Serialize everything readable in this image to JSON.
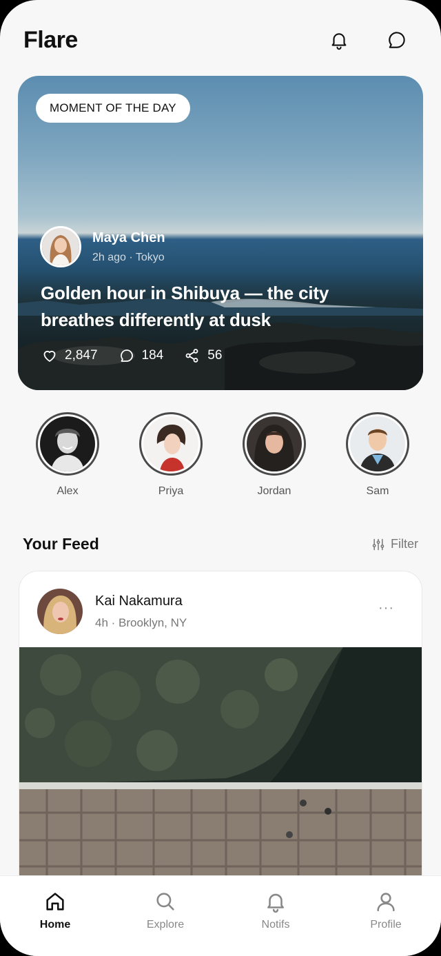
{
  "app": {
    "title": "Flare"
  },
  "header": {
    "icons": [
      "bell-icon",
      "chat-bubble-icon"
    ]
  },
  "hero": {
    "badge": "MOMENT OF THE DAY",
    "author": "Maya Chen",
    "meta": "2h ago · Tokyo",
    "title": "Golden hour in Shibuya — the city breathes differently at dusk",
    "likes": "2,847",
    "comments": "184",
    "shares": "56"
  },
  "stories": [
    {
      "name": "Alex"
    },
    {
      "name": "Priya"
    },
    {
      "name": "Jordan"
    },
    {
      "name": "Sam"
    }
  ],
  "feed": {
    "title": "Your Feed",
    "filter_label": "Filter",
    "post": {
      "author": "Kai Nakamura",
      "meta": "4h · Brooklyn, NY",
      "more": "···"
    }
  },
  "nav": {
    "items": [
      {
        "label": "Home",
        "icon": "home-icon",
        "active": true
      },
      {
        "label": "Explore",
        "icon": "search-icon",
        "active": false
      },
      {
        "label": "Notifs",
        "icon": "bell-icon",
        "active": false
      },
      {
        "label": "Profile",
        "icon": "user-icon",
        "active": false
      }
    ]
  }
}
